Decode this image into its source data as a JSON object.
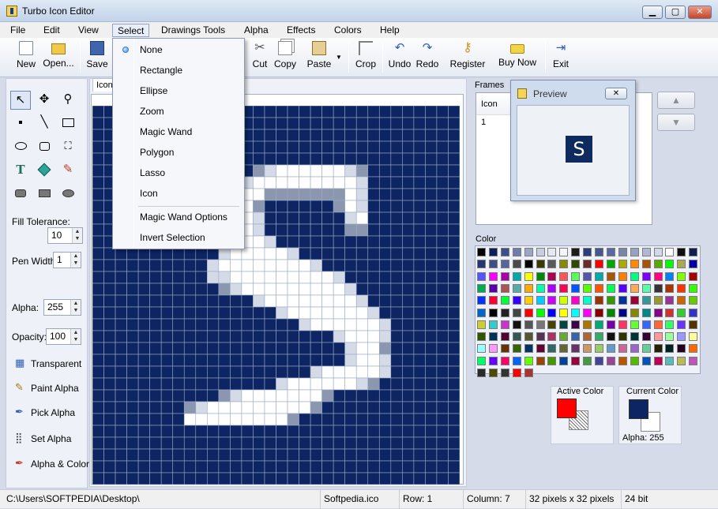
{
  "window": {
    "title": "Turbo Icon Editor",
    "min": "▁",
    "max": "▢",
    "close": "✕"
  },
  "menu": [
    "File",
    "Edit",
    "View",
    "Select",
    "Drawings Tools",
    "Alpha",
    "Effects",
    "Colors",
    "Help"
  ],
  "toolbar": {
    "new": "New",
    "open": "Open...",
    "save": "Save",
    "cut": "Cut",
    "copy": "Copy",
    "paste": "Paste",
    "crop": "Crop",
    "undo": "Undo",
    "redo": "Redo",
    "register": "Register",
    "buy": "Buy Now",
    "exit": "Exit"
  },
  "select_menu": {
    "items": [
      "None",
      "Rectangle",
      "Ellipse",
      "Zoom",
      "Magic Wand",
      "Polygon",
      "Lasso",
      "Icon",
      "Magic Wand Options",
      "Invert Selection"
    ],
    "checked": "None"
  },
  "tools": {
    "fill_tolerance_label": "Fill Tolerance:",
    "fill_tolerance": "10",
    "pen_width_label": "Pen Width:",
    "pen_width": "1",
    "alpha_label": "Alpha:",
    "alpha": "255",
    "opacity_label": "Opacity:",
    "opacity": "100",
    "transparent": "Transparent",
    "paint_alpha": "Paint Alpha",
    "pick_alpha": "Pick Alpha",
    "set_alpha": "Set Alpha",
    "alpha_color": "Alpha & Color"
  },
  "canvas": {
    "tab": "Icon",
    "cols": 32,
    "rows": 32,
    "colors": {
      "bg": "#0d2663",
      "white": "#ffffff",
      "light": "#d5dbe6",
      "mid": "#8b97ae"
    },
    "icon_rows": [
      "................................",
      "................................",
      "................................",
      "................................",
      "................................",
      "..............mlwwwwwwlm........",
      "............mlwwwwwwwwwl........",
      "...........lwwwmmmmmmmwl........",
      "...........lwwm......mwl........",
      "...........lwwl.......lw........",
      "...........lwwl.......mm........",
      "...........lwwwl................",
      "...........lwwwwwl..............",
      "..........lwwwwwwwwl............",
      "..........llwwwwwwwwwl..........",
      "...........mlwwwwwwwwwl.........",
      "..............lwwwwwwwwl........",
      "................lwwwwwwwl.......",
      "..................lwwwwwwl......",
      ".....................lwwwl......",
      "......................lwwm......",
      "......................lwwl......",
      "...................lwwwwwl......",
      "................lwwwwwwlm.......",
      "...........mlwwwwwwwm...........",
      "........mlwwwwwwwwwm............",
      "........wwwwwwwwwm..............",
      "................................",
      "................................",
      "................................",
      "................................",
      "................................"
    ]
  },
  "frames": {
    "title": "Frames",
    "col_header": "Icon",
    "row_value": "1",
    "up": "▲",
    "down": "▼"
  },
  "preview": {
    "title": "Preview",
    "close": "✕",
    "glyph": "S"
  },
  "palette": {
    "title": "Color",
    "colors": [
      "#000000",
      "#0a1f5c",
      "#3d4f8a",
      "#6d7ea8",
      "#9aa6c4",
      "#c7cedf",
      "#e6e9f2",
      "#f4f6fa",
      "#1d1d1d",
      "#2c3e7a",
      "#47568c",
      "#5a6aa0",
      "#7a85aa",
      "#96a0c0",
      "#b0b8d2",
      "#d2d8e8",
      "#ffffff",
      "#0f0f0f",
      "#101f4f",
      "#263670",
      "#3f4e86",
      "#57679b",
      "#4a4a4a",
      "#000000",
      "#3a3a00",
      "#5a5a5a",
      "#8a8a00",
      "#2e4a00",
      "#6a2a2a",
      "#ff0000",
      "#00aa00",
      "#aaaa00",
      "#ff8800",
      "#aa5500",
      "#55aa00",
      "#00ff00",
      "#aaaa55",
      "#0000aa",
      "#5555ff",
      "#ff00ff",
      "#aa00aa",
      "#00aaaa",
      "#ffff00",
      "#008800",
      "#aa0055",
      "#ff5555",
      "#55ff55",
      "#5555aa",
      "#00aaaa",
      "#aa5500",
      "#ff7f00",
      "#00ff7f",
      "#7f00ff",
      "#ff007f",
      "#007fff",
      "#7fff00",
      "#aa0000",
      "#00aa55",
      "#5500aa",
      "#aa5555",
      "#55aaaa",
      "#ffaa00",
      "#00ffaa",
      "#aa00ff",
      "#ff0055",
      "#0055ff",
      "#55ff00",
      "#ff5500",
      "#00ff55",
      "#5500ff",
      "#ffaa55",
      "#55ffaa",
      "#333333",
      "#aa3300",
      "#ff3300",
      "#33ff00",
      "#0033ff",
      "#ff0033",
      "#00ff33",
      "#3300ff",
      "#ffcc00",
      "#00ccff",
      "#cc00ff",
      "#ccff00",
      "#ff00cc",
      "#00ffcc",
      "#993300",
      "#339900",
      "#003399",
      "#990033",
      "#339999",
      "#999933",
      "#993399",
      "#cc6600",
      "#66cc00",
      "#0066cc",
      "#000000",
      "#222222",
      "#444444",
      "#ff0000",
      "#00ff00",
      "#0000ff",
      "#ffff00",
      "#00ffff",
      "#ff00ff",
      "#880000",
      "#008800",
      "#000088",
      "#888800",
      "#008888",
      "#880088",
      "#cc3333",
      "#33cc33",
      "#3333cc",
      "#cccc33",
      "#33cccc",
      "#cc33cc",
      "#111111",
      "#555555",
      "#777777",
      "#444400",
      "#004444",
      "#440044",
      "#aa7700",
      "#00aa77",
      "#7700aa",
      "#ff3366",
      "#66ff33",
      "#3366ff",
      "#ff6633",
      "#33ff66",
      "#6633ff",
      "#553300",
      "#335500",
      "#003355",
      "#550033",
      "#335555",
      "#555533",
      "#553355",
      "#aa3366",
      "#66aa33",
      "#3366aa",
      "#aa6633",
      "#33aa66",
      "#111111",
      "#333300",
      "#003333",
      "#330033",
      "#ff9999",
      "#99ff99",
      "#9999ff",
      "#ffff99",
      "#99ffff",
      "#ff99ff",
      "#663300",
      "#336600",
      "#003366",
      "#660033",
      "#336666",
      "#666633",
      "#663366",
      "#cc9966",
      "#99cc66",
      "#6699cc",
      "#cc6699",
      "#9966cc",
      "#66cc99",
      "#222200",
      "#002222",
      "#220022",
      "#ff6600",
      "#00ff66",
      "#6600ff",
      "#ff0066",
      "#0066ff",
      "#66ff00",
      "#994400",
      "#449900",
      "#004499",
      "#990044",
      "#449944",
      "#444499",
      "#994499",
      "#bb5500",
      "#55bb00",
      "#0055bb",
      "#bb0055",
      "#55bbbb",
      "#bbbb55",
      "#bb55bb",
      "#2a2a2a",
      "#4a4a00",
      "#333333",
      "#ff0000",
      "#aa3333"
    ],
    "count": 195
  },
  "active_color": {
    "title": "Active Color",
    "front": "#ff0000"
  },
  "current_color": {
    "title": "Current Color",
    "front": "#0d2663",
    "alpha": "Alpha: 255"
  },
  "status": {
    "path": "C:\\Users\\SOFTPEDIA\\Desktop\\",
    "file": "Softpedia.ico",
    "row": "Row: 1",
    "column": "Column: 7",
    "size": "32 pixels x 32 pixels",
    "depth": "24 bit"
  }
}
